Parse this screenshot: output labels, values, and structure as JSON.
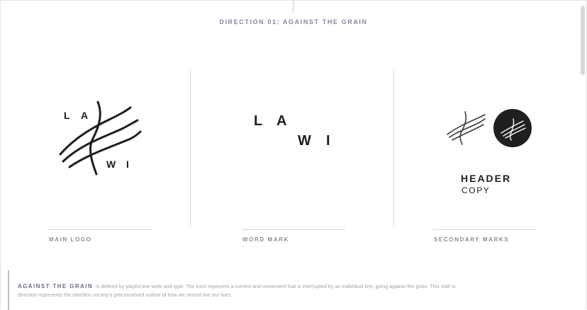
{
  "heading": "DIRECTION 01: AGAINST THE GRAIN",
  "main_logo": {
    "letters": [
      "L",
      "A",
      "W",
      "I"
    ],
    "caption": "MAIN LOGO"
  },
  "word_mark": {
    "letters": [
      "L",
      "A",
      "W",
      "I"
    ],
    "caption": "WORD MARK"
  },
  "secondary_marks": {
    "header_text": "HEADER",
    "copy_text": "COPY",
    "caption": "SECONDARY MARKS"
  },
  "description": {
    "lead": "AGAINST THE GRAIN",
    "body": "is defined by playful line work and type. The lines represent a current and movement that is interrupted by an individual line, going against the grain. This shift in direction represents the rebellion society's preconceived outline of how we should live our lives."
  },
  "colors": {
    "heading": "#8a84a6",
    "mark": "#1f1f1f",
    "divider": "#dadada",
    "caption": "#8e8e8e"
  }
}
